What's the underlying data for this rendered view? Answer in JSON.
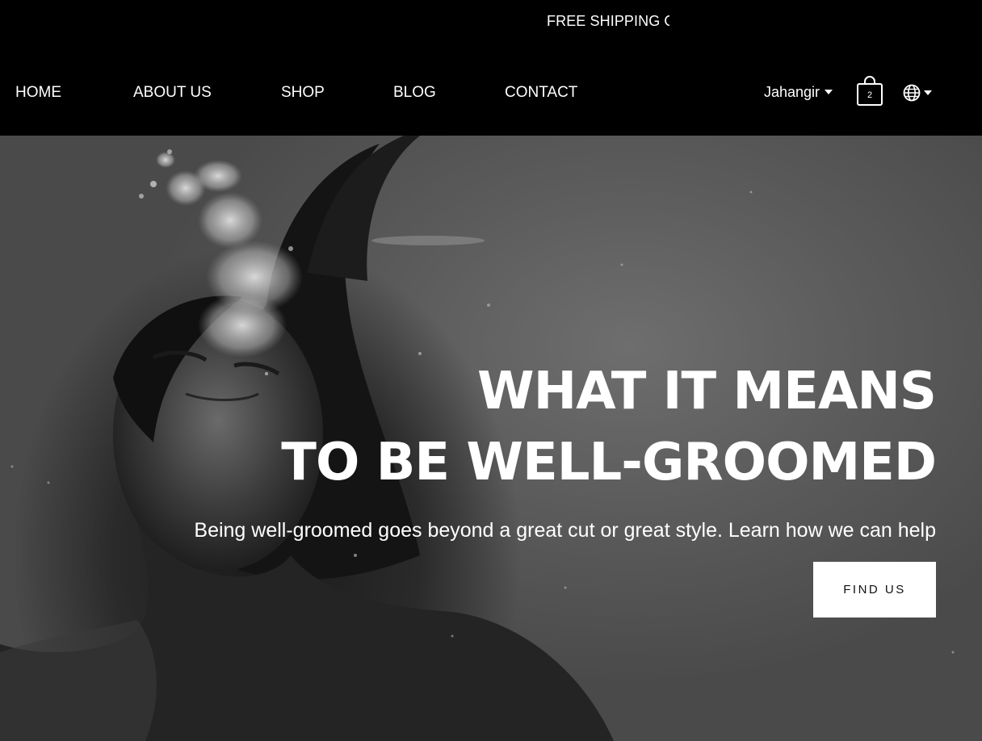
{
  "announcement": {
    "text": "FREE SHIPPING ON ALL ORDERS"
  },
  "nav": {
    "items": [
      {
        "label": "HOME"
      },
      {
        "label": "ABOUT US"
      },
      {
        "label": "SHOP"
      },
      {
        "label": "BLOG"
      },
      {
        "label": "CONTACT"
      }
    ]
  },
  "account": {
    "name": "Jahangir"
  },
  "cart": {
    "count": "2"
  },
  "language": {
    "icon": "globe-icon"
  },
  "hero": {
    "title_line1": "WHAT IT MEANS",
    "title_line2": "TO BE WELL-GROOMED",
    "subtitle": "Being well-groomed goes beyond a great cut or great style. Learn how we can help",
    "cta_label": "FIND US"
  },
  "colors": {
    "header_bg": "#000000",
    "text": "#ffffff",
    "cta_bg": "#ffffff",
    "cta_text": "#111111"
  }
}
